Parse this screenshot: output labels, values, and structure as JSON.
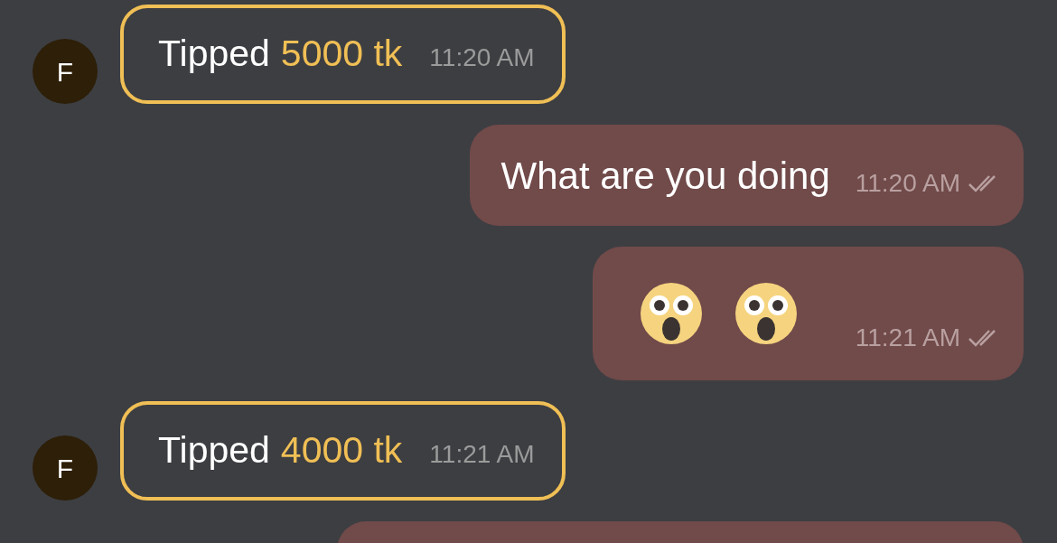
{
  "messages": [
    {
      "kind": "tip",
      "outgoing": false,
      "avatar": "F",
      "label": "Tipped",
      "amount": "5000 tk",
      "time": "11:20 AM"
    },
    {
      "kind": "text",
      "outgoing": true,
      "text": "What are you doing",
      "time": "11:20 AM",
      "read": true
    },
    {
      "kind": "emoji",
      "outgoing": true,
      "emojis": [
        {
          "kind": "shocked"
        },
        {
          "kind": "shocked"
        }
      ],
      "time": "11:21 AM",
      "read": true
    },
    {
      "kind": "tip",
      "outgoing": false,
      "avatar": "F",
      "label": "Tipped",
      "amount": "4000 tk",
      "time": "11:21 AM"
    },
    {
      "kind": "partial",
      "outgoing": true
    }
  ]
}
